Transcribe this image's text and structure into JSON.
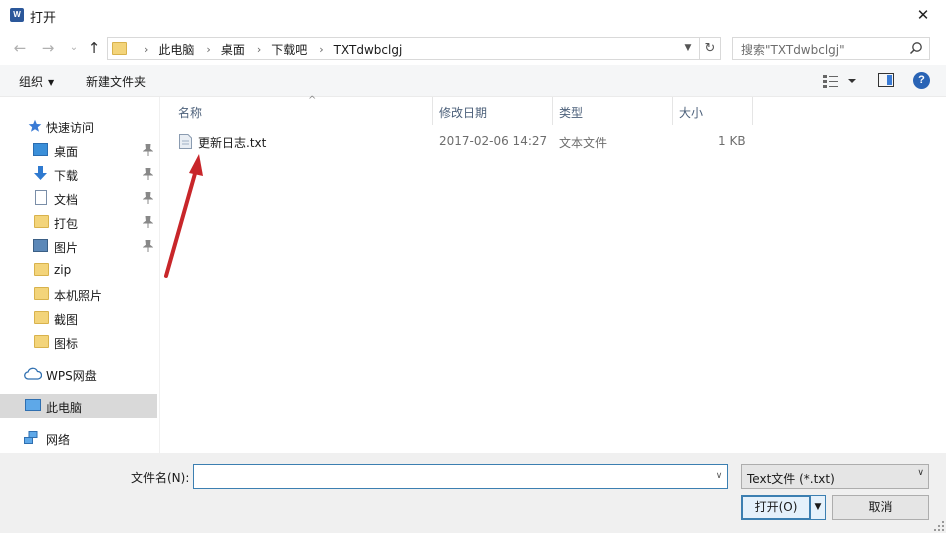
{
  "window": {
    "title": "打开",
    "app_icon_text": "W",
    "close_glyph": "✕"
  },
  "nav": {
    "back_glyph": "←",
    "forward_glyph": "→",
    "recent_glyph": "⌄",
    "up_glyph": "↑",
    "breadcrumbs": [
      "此电脑",
      "桌面",
      "下载吧",
      "TXTdwbclgj"
    ],
    "crumb_separator": "›",
    "dropdown_glyph": "▼",
    "refresh_glyph": "↻",
    "search_placeholder": "搜索\"TXTdwbclgj\""
  },
  "toolbar": {
    "organize_label": "组织",
    "new_folder_label": "新建文件夹",
    "caret_glyph": "▼",
    "help_label": "?"
  },
  "sidebar": {
    "quick_access": {
      "label": "快速访问",
      "icon": "star-icon"
    },
    "items": [
      {
        "label": "桌面",
        "icon": "desktop-icon",
        "pinned": true
      },
      {
        "label": "下载",
        "icon": "download-icon",
        "pinned": true
      },
      {
        "label": "文档",
        "icon": "document-icon",
        "pinned": true
      },
      {
        "label": "打包",
        "icon": "folder-icon",
        "pinned": true
      },
      {
        "label": "图片",
        "icon": "pictures-icon",
        "pinned": true
      },
      {
        "label": "zip",
        "icon": "folder-icon",
        "pinned": false
      },
      {
        "label": "本机照片",
        "icon": "folder-icon",
        "pinned": false
      },
      {
        "label": "截图",
        "icon": "folder-icon",
        "pinned": false
      },
      {
        "label": "图标",
        "icon": "folder-icon",
        "pinned": false
      }
    ],
    "wps": {
      "label": "WPS网盘",
      "icon": "cloud-icon"
    },
    "this_pc": {
      "label": "此电脑",
      "icon": "computer-icon",
      "selected": true
    },
    "network": {
      "label": "网络",
      "icon": "network-icon"
    }
  },
  "columns": {
    "name": "名称",
    "modified": "修改日期",
    "type": "类型",
    "size": "大小",
    "sort_glyph": "^"
  },
  "files": [
    {
      "name": "更新日志.txt",
      "modified": "2017-02-06 14:27",
      "type": "文本文件",
      "size": "1 KB",
      "icon": "text-file-icon"
    }
  ],
  "bottom": {
    "filename_label": "文件名(N):",
    "filename_value": "",
    "filename_caret": "∨",
    "filetype_value": "Text文件 (*.txt)",
    "filetype_caret": "∨",
    "open_label": "打开(O)",
    "open_split_glyph": "▼",
    "cancel_label": "取消"
  },
  "colors": {
    "accent": "#3c7fb1",
    "selected_sidebar": "#d9d9d9",
    "annotation_arrow": "#c8262a"
  }
}
